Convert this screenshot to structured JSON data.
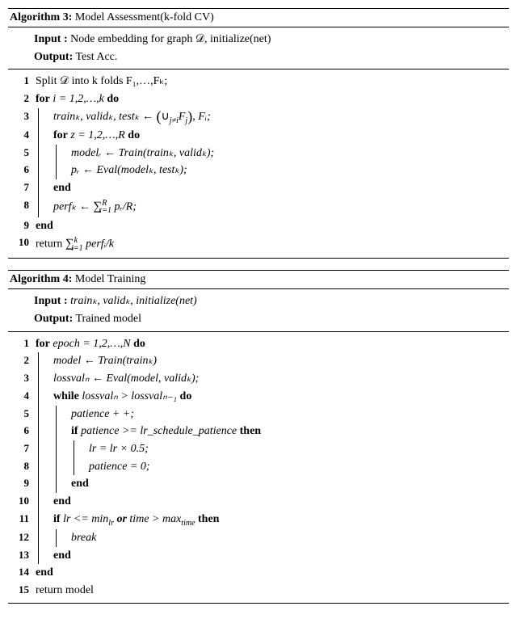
{
  "algo3": {
    "title_label": "Algorithm 3:",
    "title_text": "Model Assessment(k-fold CV)",
    "input_label": "Input   :",
    "input_text": "Node embedding for graph 𝒟, initialize(net)",
    "output_label": "Output:",
    "output_text": "Test Acc.",
    "lines": {
      "l1": "Split 𝒟 into k folds F₁,…,Fₖ;",
      "l2_a": "for",
      "l2_b": " i = 1,2,…,k ",
      "l2_c": "do",
      "l3_a": "trainₖ, validₖ, testₖ ← ",
      "l3_b": "(",
      "l3_c": "∪",
      "l3_d": "j≠i",
      "l3_e": "F",
      "l3_f": "j",
      "l3_g": ")",
      "l3_h": ", Fᵢ;",
      "l4_a": "for",
      "l4_b": " z = 1,2,…,R ",
      "l4_c": "do",
      "l5": "modelᵣ ← Train(trainₖ, validₖ);",
      "l6": "pᵣ ← Eval(modelₖ, testₖ);",
      "l7": "end",
      "l8_a": "perfₖ ← ",
      "l8_b": "∑",
      "l8_c": "R",
      "l8_d": "r=1",
      "l8_e": " pᵣ/R;",
      "l9": "end",
      "l10_a": "return ",
      "l10_b": "∑",
      "l10_c": "k",
      "l10_d": "i=1",
      "l10_e": " perfᵢ/k"
    }
  },
  "algo4": {
    "title_label": "Algorithm 4:",
    "title_text": "Model Training",
    "input_label": "Input   :",
    "input_text": "trainₖ, validₖ, initialize(net)",
    "output_label": "Output:",
    "output_text": "Trained model",
    "lines": {
      "l1_a": "for",
      "l1_b": " epoch = 1,2,…,N ",
      "l1_c": "do",
      "l2": "model ← Train(trainₖ)",
      "l3": "lossvalₙ ← Eval(model, validₖ);",
      "l4_a": "while",
      "l4_b": " lossvalₙ > lossvalₙ₋₁ ",
      "l4_c": "do",
      "l5": "patience + +;",
      "l6_a": "if",
      "l6_b": " patience >= lr_schedule_patience ",
      "l6_c": "then",
      "l7": "lr = lr × 0.5;",
      "l8": "patience = 0;",
      "l9": "end",
      "l10": "end",
      "l11_a": "if",
      "l11_b": " lr <= min",
      "l11_c": "lr",
      "l11_d": " or ",
      "l11_e": "time > max",
      "l11_f": "time",
      "l11_g": " ",
      "l11_h": "then",
      "l12": "break",
      "l13": "end",
      "l14": "end",
      "l15": "return model"
    }
  }
}
